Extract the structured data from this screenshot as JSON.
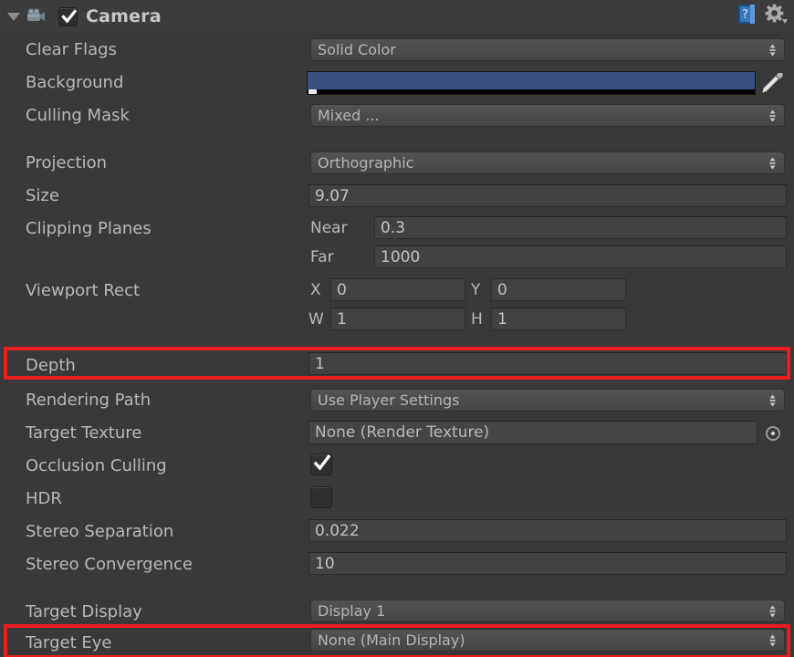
{
  "header": {
    "title": "Camera",
    "foldout_icon": "triangle-down-icon",
    "component_icon": "camera-icon",
    "enabled_checkbox": "checked",
    "help_icon": "help-book-icon",
    "settings_icon": "gear-dropdown-icon"
  },
  "colors": {
    "panel_bg": "#393939",
    "header_bg": "#3c3c3c",
    "background_color_swatch": "#3a5182",
    "highlight": "#ed1c1c",
    "label_text": "#b9b9b9"
  },
  "fields": {
    "clear_flags": {
      "label": "Clear Flags",
      "value": "Solid Color"
    },
    "background": {
      "label": "Background",
      "value": "#3a5182"
    },
    "culling_mask": {
      "label": "Culling Mask",
      "value": "Mixed ..."
    },
    "projection": {
      "label": "Projection",
      "value": "Orthographic"
    },
    "size": {
      "label": "Size",
      "value": "9.07"
    },
    "clipping_planes": {
      "label": "Clipping Planes",
      "near_label": "Near",
      "near": "0.3",
      "far_label": "Far",
      "far": "1000"
    },
    "viewport_rect": {
      "label": "Viewport Rect",
      "x_label": "X",
      "x": "0",
      "y_label": "Y",
      "y": "0",
      "w_label": "W",
      "w": "1",
      "h_label": "H",
      "h": "1"
    },
    "depth": {
      "label": "Depth",
      "value": "1"
    },
    "rendering_path": {
      "label": "Rendering Path",
      "value": "Use Player Settings"
    },
    "target_texture": {
      "label": "Target Texture",
      "value": "None (Render Texture)"
    },
    "occlusion_culling": {
      "label": "Occlusion Culling",
      "value": "checked"
    },
    "hdr": {
      "label": "HDR",
      "value": "unchecked"
    },
    "stereo_separation": {
      "label": "Stereo Separation",
      "value": "0.022"
    },
    "stereo_convergence": {
      "label": "Stereo Convergence",
      "value": "10"
    },
    "target_display": {
      "label": "Target Display",
      "value": "Display 1"
    },
    "target_eye": {
      "label": "Target Eye",
      "value": "None (Main Display)"
    }
  },
  "icons": {
    "eyedropper": "eyedropper-icon",
    "object_picker": "object-picker-icon",
    "stepper": "updown-stepper-icon"
  },
  "highlights": [
    {
      "target": "depth-row"
    },
    {
      "target": "target-eye-row"
    }
  ]
}
